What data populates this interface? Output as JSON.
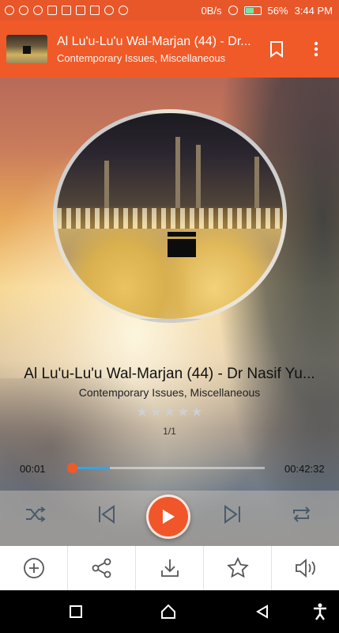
{
  "status_bar": {
    "net_speed": "0B/s",
    "battery": "56%",
    "time": "3:44 PM",
    "icons": [
      "chat-icon",
      "message-icon",
      "whatsapp-icon",
      "mail-icon",
      "tshirt-icon",
      "lock-icon",
      "image-icon",
      "cloud-icon",
      "wifi-icon",
      "alarm-icon",
      "battery-icon"
    ]
  },
  "toolbar": {
    "title": "Al Lu'u-Lu'u Wal-Marjan (44) - Dr...",
    "subtitle": "Contemporary Issues, Miscellaneous",
    "icons": [
      "bookmark-icon",
      "more-vert-icon"
    ]
  },
  "player": {
    "title": "Al Lu'u-Lu'u Wal-Marjan (44) - Dr Nasif Yu...",
    "subtitle": "Contemporary Issues, Miscellaneous",
    "rating": 0,
    "rating_max": 5,
    "page": "1/1",
    "current_time": "00:01",
    "duration": "00:42:32",
    "progress_fraction": 0.003,
    "buffered_fraction": 0.2,
    "accent_color": "#f05a28",
    "buffer_color": "#35a5e8",
    "controls": [
      "shuffle-icon",
      "previous-icon",
      "play-icon",
      "next-icon",
      "repeat-icon"
    ]
  },
  "bottom_bar": {
    "icons": [
      "add-icon",
      "share-icon",
      "download-icon",
      "favorite-icon",
      "volume-icon"
    ]
  },
  "nav_bar": {
    "icons": [
      "recent-apps-icon",
      "home-icon",
      "back-icon",
      "accessibility-icon"
    ]
  }
}
